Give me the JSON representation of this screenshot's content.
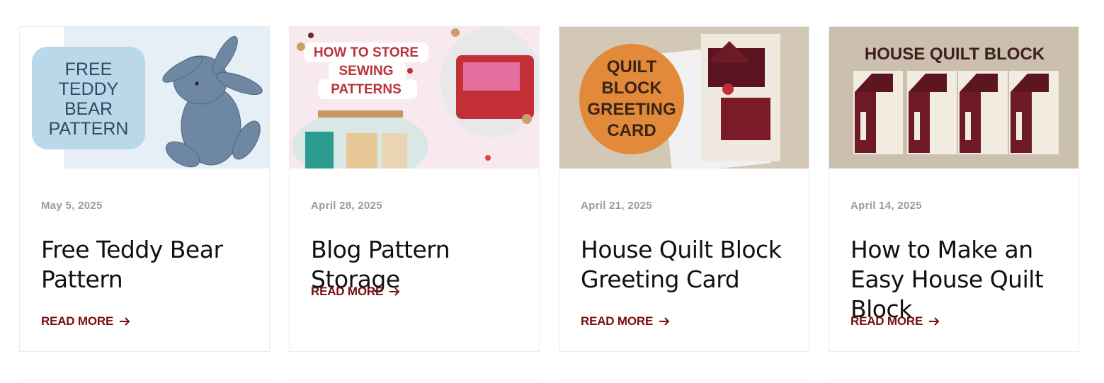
{
  "cards": [
    {
      "date": "May 5, 2025",
      "title": "Free Teddy Bear Pattern",
      "read_more": "READ MORE",
      "thumb_text": [
        "FREE",
        "TEDDY",
        "BEAR",
        "PATTERN"
      ]
    },
    {
      "date": "April 28, 2025",
      "title": "Blog Pattern Storage",
      "read_more": "READ MORE",
      "thumb_text": [
        "HOW TO STORE",
        "SEWING",
        "PATTERNS"
      ]
    },
    {
      "date": "April 21, 2025",
      "title": "House Quilt Block Greeting Card",
      "read_more": "READ MORE",
      "thumb_text": [
        "QUILT",
        "BLOCK",
        "GREETING",
        "CARD"
      ]
    },
    {
      "date": "April 14, 2025",
      "title": "How to Make an Easy House Quilt Block",
      "read_more": "READ MORE",
      "thumb_text": [
        "HOUSE QUILT BLOCK"
      ]
    }
  ],
  "colors": {
    "accent": "#7a0d0d",
    "date": "#9b9b9b",
    "title": "#111111"
  }
}
